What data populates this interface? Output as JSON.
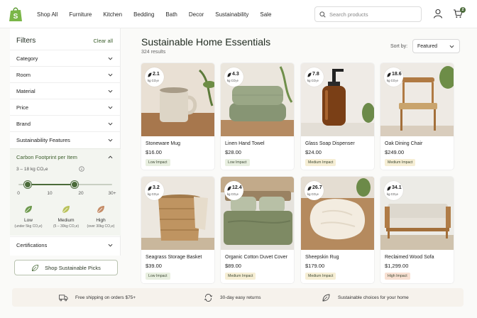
{
  "nav": {
    "items": [
      "Shop All",
      "Furniture",
      "Kitchen",
      "Bedding",
      "Bath",
      "Decor",
      "Sustainability",
      "Sale"
    ]
  },
  "search": {
    "placeholder": "Search products"
  },
  "cart": {
    "count": "2"
  },
  "filters": {
    "title": "Filters",
    "clear_all": "Clear all",
    "sections": [
      "Category",
      "Room",
      "Material",
      "Price",
      "Brand",
      "Sustainability Features"
    ],
    "carbon": {
      "title": "Carbon Footprint per Item",
      "range_label": "3 – 18 kg CO₂e",
      "range_min": 3,
      "range_max": 18,
      "ticks": [
        "0",
        "10",
        "20",
        "30+"
      ],
      "impacts": [
        {
          "label": "Low",
          "sub": "(under 5kg CO₂e)",
          "color": "#6e9a4e"
        },
        {
          "label": "Medium",
          "sub": "(5 – 30kg CO₂e)",
          "color": "#b9c25b"
        },
        {
          "label": "High",
          "sub": "(over 30kg CO₂e)",
          "color": "#c58c67"
        }
      ]
    },
    "certifications": "Certifications",
    "shop_button": "Shop Sustainable Picks"
  },
  "main": {
    "title": "Sustainable Home Essentials",
    "results": "324 results",
    "sort_label": "Sort by:",
    "sort_value": "Featured"
  },
  "co2_unit": "kg CO₂e",
  "products": [
    {
      "name": "Stoneware Mug",
      "price": "$16.00",
      "co2": "2.1",
      "impact": "Low Impact",
      "level": "low"
    },
    {
      "name": "Linen Hand Towel",
      "price": "$28.00",
      "co2": "4.3",
      "impact": "Low Impact",
      "level": "low"
    },
    {
      "name": "Glass Soap Dispenser",
      "price": "$24.00",
      "co2": "7.8",
      "impact": "Medium Impact",
      "level": "med"
    },
    {
      "name": "Oak Dining Chair",
      "price": "$249.00",
      "co2": "18.6",
      "impact": "Medium Impact",
      "level": "med"
    },
    {
      "name": "Seagrass Storage Basket",
      "price": "$39.00",
      "co2": "3.2",
      "impact": "Low Impact",
      "level": "low"
    },
    {
      "name": "Organic Cotton Duvet Cover",
      "price": "$89.00",
      "co2": "12.4",
      "impact": "Medium Impact",
      "level": "med"
    },
    {
      "name": "Sheepskin Rug",
      "price": "$179.00",
      "co2": "26.7",
      "impact": "Medium Impact",
      "level": "med"
    },
    {
      "name": "Reclaimed Wood Sofa",
      "price": "$1,299.00",
      "co2": "34.1",
      "impact": "High Impact",
      "level": "high"
    }
  ],
  "footer": [
    {
      "text": "Free shipping on orders $75+",
      "icon": "truck-icon"
    },
    {
      "text": "30-day easy returns",
      "icon": "returns-icon"
    },
    {
      "text": "Sustainable choices for your home",
      "icon": "leaf-icon"
    }
  ],
  "colors": {
    "accent": "#4b6b3a",
    "low": "#e8efe0",
    "medium": "#f6eed4",
    "high": "#f8e0d2",
    "footer_bg": "#f6f2ec"
  }
}
